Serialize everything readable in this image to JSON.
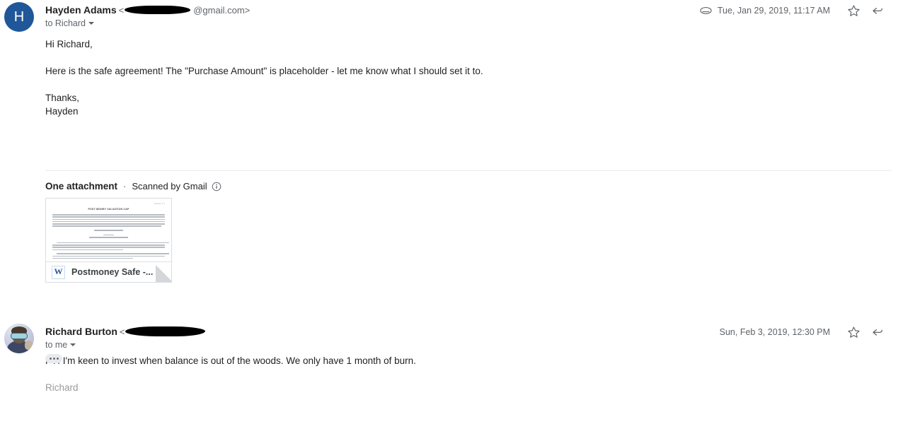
{
  "messages": [
    {
      "avatar": {
        "type": "letter",
        "letter": "H",
        "color": "#1f5799"
      },
      "sender_name": "Hayden Adams",
      "email_prefix": "<",
      "email_suffix": "@gmail.com>",
      "recipient": "to Richard",
      "timestamp": "Tue, Jan 29, 2019, 11:17 AM",
      "has_attachment_icon": true,
      "body": [
        "Hi Richard,",
        "",
        "Here is the safe agreement! The \"Purchase Amount\" is placeholder - let me know what I should set it to.",
        "",
        "Thanks,",
        "Hayden"
      ]
    },
    {
      "avatar": {
        "type": "photo"
      },
      "sender_name": "Richard Burton",
      "email_prefix": "<",
      "email_suffix": "",
      "recipient": "to me",
      "timestamp": "Sun, Feb 3, 2019, 12:30 PM",
      "has_attachment_icon": false,
      "body": [
        "FYI I'm keen to invest when balance is out of the woods. We only have 1 month of burn."
      ],
      "signature": "Richard",
      "trimmed_label": "..."
    }
  ],
  "attachment_section": {
    "count_label": "One attachment",
    "separator": "·",
    "scanned_label": "Scanned by Gmail",
    "info_icon": "info-icon",
    "card": {
      "filename": "Postmoney Safe -...",
      "file_type_icon": "W",
      "preview_title": "POST-MONEY VALUATION CAP",
      "preview_pagenum": "Version 1.0",
      "preview_center_1": "COMPANY NAME",
      "preview_center_2": "SAFE",
      "preview_center_3": "(Simple Agreement for Future Equity)",
      "accent_color": "#4285f4"
    }
  },
  "icons": {
    "attachment": "paperclip-icon",
    "star": "star-icon",
    "reply": "reply-icon",
    "dropdown": "chevron-down-icon"
  }
}
